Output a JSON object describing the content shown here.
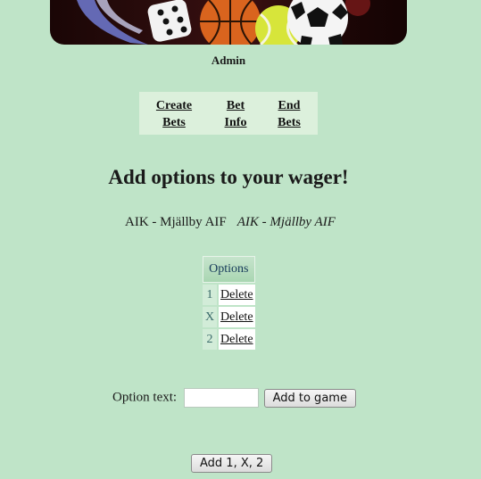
{
  "header": {
    "user_label": "Admin"
  },
  "nav": {
    "create_bets": [
      "Create",
      "Bets"
    ],
    "bet_info": [
      "Bet",
      "Info"
    ],
    "end_bets": [
      "End",
      "Bets"
    ]
  },
  "page_title": "Add options to your wager!",
  "match": {
    "name": "AIK - Mjällby AIF",
    "name_italic": "AIK - Mjällby AIF"
  },
  "options_table": {
    "header": "Options",
    "rows": [
      {
        "symbol": "1",
        "action": "Delete"
      },
      {
        "symbol": "X",
        "action": "Delete"
      },
      {
        "symbol": "2",
        "action": "Delete"
      }
    ]
  },
  "add_option": {
    "label": "Option text:",
    "value": "",
    "button": "Add to game"
  },
  "add_1x2_button": "Add 1, X, 2",
  "colors": {
    "background": "#bfe4c8",
    "nav_background": "#dcf0dc",
    "table_header": "#a9d6b2"
  },
  "icons": [
    "dice-icon",
    "basketball-icon",
    "tennis-ball-icon",
    "soccer-ball-icon"
  ]
}
